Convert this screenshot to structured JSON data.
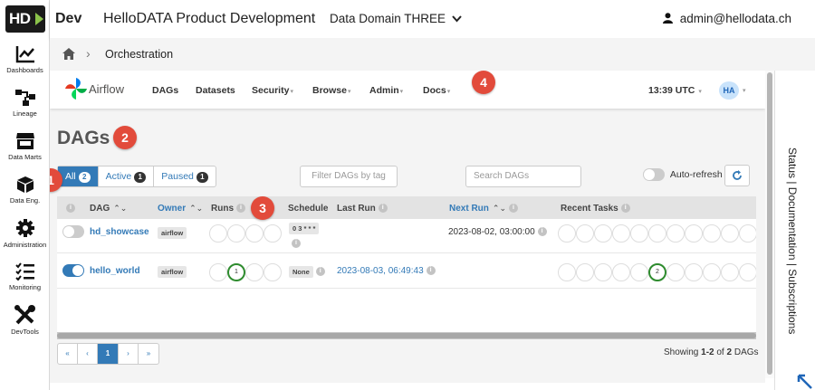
{
  "topbar": {
    "logo_text": "HD",
    "env": "Dev",
    "title": "HelloDATA Product Development",
    "domain": "Data Domain THREE",
    "user": "admin@hellodata.ch"
  },
  "sidebar": {
    "items": [
      {
        "label": "Dashboards",
        "icon": "chart-line-icon"
      },
      {
        "label": "Lineage",
        "icon": "lineage-icon"
      },
      {
        "label": "Data Marts",
        "icon": "store-icon"
      },
      {
        "label": "Data Eng.",
        "icon": "cube-icon"
      },
      {
        "label": "Administration",
        "icon": "gear-icon"
      },
      {
        "label": "Monitoring",
        "icon": "checklist-icon"
      },
      {
        "label": "DevTools",
        "icon": "tools-icon"
      }
    ]
  },
  "breadcrumb": {
    "current": "Orchestration"
  },
  "airflow": {
    "logo_text": "Airflow",
    "menu": [
      "DAGs",
      "Datasets",
      "Security",
      "Browse",
      "Admin",
      "Docs"
    ],
    "menu_dropdown": [
      false,
      false,
      true,
      true,
      true,
      true
    ],
    "time": "13:39 UTC",
    "avatar": "HA"
  },
  "annotations": [
    "1",
    "2",
    "3",
    "4"
  ],
  "page": {
    "title": "DAGs",
    "filters": {
      "all_label": "All",
      "all_count": "2",
      "active_label": "Active",
      "active_count": "1",
      "paused_label": "Paused",
      "paused_count": "1"
    },
    "tag_placeholder": "Filter DAGs by tag",
    "search_placeholder": "Search DAGs",
    "auto_refresh": "Auto-refresh",
    "auto_refresh_on": false
  },
  "table": {
    "headers": {
      "info": "i",
      "dag": "DAG",
      "owner": "Owner",
      "runs": "Runs",
      "schedule": "Schedule",
      "last_run": "Last Run",
      "next_run": "Next Run",
      "recent_tasks": "Recent Tasks"
    },
    "rows": [
      {
        "enabled": false,
        "dag": "hd_showcase",
        "owner": "airflow",
        "runs": [
          "",
          "",
          "",
          ""
        ],
        "schedule": "0 3 * * *",
        "last_run": "",
        "next_run": "2023-08-02, 03:00:00",
        "tasks": [
          "",
          "",
          "",
          "",
          "",
          "",
          "",
          "",
          "",
          "",
          ""
        ]
      },
      {
        "enabled": true,
        "dag": "hello_world",
        "owner": "airflow",
        "runs": [
          "",
          "1",
          "",
          ""
        ],
        "schedule": "None",
        "last_run": "2023-08-03, 06:49:43",
        "next_run": "",
        "tasks": [
          "",
          "",
          "",
          "",
          "",
          "2",
          "",
          "",
          "",
          "",
          ""
        ]
      }
    ]
  },
  "pagination": {
    "first": "«",
    "prev": "‹",
    "current": "1",
    "next": "›",
    "last": "»"
  },
  "showing": {
    "prefix": "Showing ",
    "range": "1-2",
    "mid": " of ",
    "total": "2",
    "suffix": " DAGs"
  },
  "rail": {
    "text": "Status | Documentation | Subscriptions"
  },
  "colors": {
    "accent": "#337ab7",
    "badge": "#e24b3b",
    "success": "#2e8b2e"
  }
}
